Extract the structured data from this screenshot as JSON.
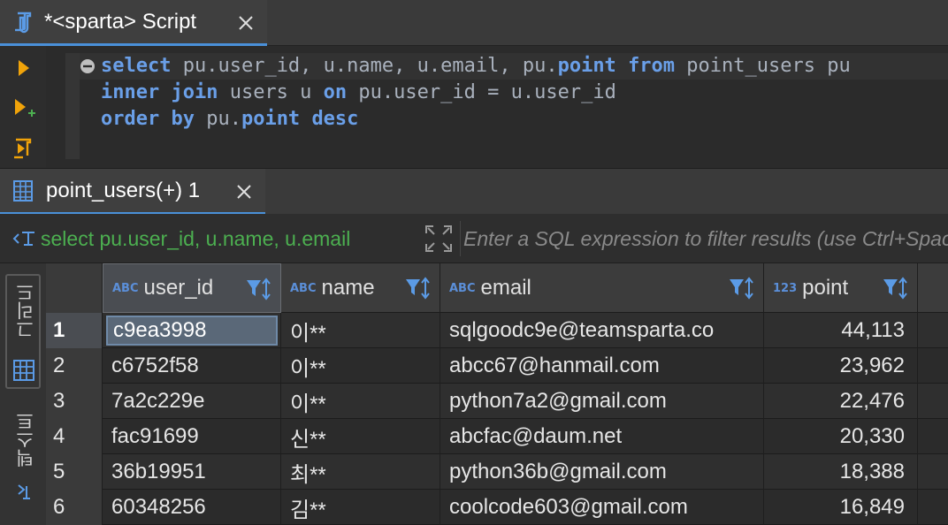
{
  "editor_tab": {
    "title": "*<sparta> Script",
    "icon": "sql-script-icon"
  },
  "editor": {
    "gutter_buttons": [
      "execute-statement-icon",
      "execute-in-new-tab-icon",
      "execute-script-icon"
    ],
    "code_lines": [
      [
        {
          "t": "kw",
          "v": "select"
        },
        {
          "t": "id",
          "v": " pu.user_id, u.name, u.email, pu."
        },
        {
          "t": "kw",
          "v": "point"
        },
        {
          "t": "id",
          "v": " "
        },
        {
          "t": "kw",
          "v": "from"
        },
        {
          "t": "id",
          "v": " point_users pu"
        }
      ],
      [
        {
          "t": "kw",
          "v": "inner join"
        },
        {
          "t": "id",
          "v": " users u "
        },
        {
          "t": "kw",
          "v": "on"
        },
        {
          "t": "id",
          "v": " pu.user_id = u.user_id"
        }
      ],
      [
        {
          "t": "kw",
          "v": "order by"
        },
        {
          "t": "id",
          "v": " pu."
        },
        {
          "t": "kw",
          "v": "point"
        },
        {
          "t": "id",
          "v": " "
        },
        {
          "t": "kw",
          "v": "desc"
        }
      ]
    ]
  },
  "results_tab": {
    "title": "point_users(+) 1",
    "icon": "table-grid-icon"
  },
  "filter": {
    "source_query": "select pu.user_id, u.name, u.email",
    "placeholder": "Enter a SQL expression to filter results (use Ctrl+Space)"
  },
  "side_panel": {
    "grid_label": "그리드",
    "text_label": "텍스트"
  },
  "grid": {
    "columns": [
      {
        "name": "user_id",
        "type": "ABC"
      },
      {
        "name": "name",
        "type": "ABC"
      },
      {
        "name": "email",
        "type": "ABC"
      },
      {
        "name": "point",
        "type": "123"
      }
    ],
    "rows": [
      {
        "num": "1",
        "user_id": "c9ea3998",
        "name": "이**",
        "email": "sqlgoodc9e@teamsparta.co",
        "point": "44,113"
      },
      {
        "num": "2",
        "user_id": "c6752f58",
        "name": "이**",
        "email": "abcc67@hanmail.com",
        "point": "23,962"
      },
      {
        "num": "3",
        "user_id": "7a2c229e",
        "name": "이**",
        "email": "python7a2@gmail.com",
        "point": "22,476"
      },
      {
        "num": "4",
        "user_id": "fac91699",
        "name": "신**",
        "email": "abcfac@daum.net",
        "point": "20,330"
      },
      {
        "num": "5",
        "user_id": "36b19951",
        "name": "최**",
        "email": "python36b@gmail.com",
        "point": "18,388"
      },
      {
        "num": "6",
        "user_id": "60348256",
        "name": "김**",
        "email": "coolcode603@gmail.com",
        "point": "16,849"
      }
    ],
    "selected_row": "1"
  },
  "colors": {
    "accent": "#4a90d9",
    "keyword": "#6a9fe8",
    "run_arrow": "#f0a30a",
    "source_text": "#4caf50"
  }
}
